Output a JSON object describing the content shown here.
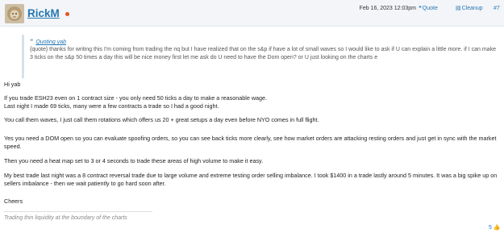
{
  "author": {
    "name": "RickM"
  },
  "header": {
    "date": "Feb 16, 2023 12:03pm",
    "quote_label": "Quote",
    "cleanup_label": "Cleanup",
    "post_number": "#7"
  },
  "quote": {
    "author_link": "Quoting yab",
    "text": "{quote} thanks for writing this I'm coming from trading the nq but I have realized that on the s&p if have a lot of small waves so I would like to ask if U can explain a little more. if I can make 3 ticks on the s&p 50 times a day this will be nice money first let me ask do U need to have the Dom open? or U just looking on the charts e"
  },
  "body": {
    "greeting": "Hi yab",
    "p1_line1": "If you trade ESH23 even on 1 contract size - you only need 50 ticks a day to make a reasonable wage.",
    "p1_line2": "Last night I made 69 ticks, many were a few contracts a trade so I had a good night.",
    "p2": "You call them waves, I just call them rotations which offers us 20 + great setups a day even before NYO comes in full flight.",
    "p3": "Yes you need a DOM open so you can evaluate spoofing orders, so you can see back ticks more clearly, see how market orders are attacking resting orders and just get in sync with the market speed.",
    "p4": "Then you need a heat map set to 3 or 4 seconds to trade these areas of high volume to make it easy.",
    "p5": "My best trade last night was a 8 contract reversal trade due to large volume and extreme testing order selling imbalance. I took $1400 in a trade lastly around 5 minutes. It was a big spike up on sellers imbalance - then we wait patiently to go hard soon after.",
    "closing": "Cheers"
  },
  "signature": "Trading thin liquidity at the boundary of the charts",
  "reactions": {
    "count": "5"
  },
  "colors": {
    "link": "#2577b1",
    "header_bg": "#f3f5f8",
    "quote_rule": "#d8e0ea",
    "flag": "#e4532d",
    "thumb": "#e8a33d"
  }
}
